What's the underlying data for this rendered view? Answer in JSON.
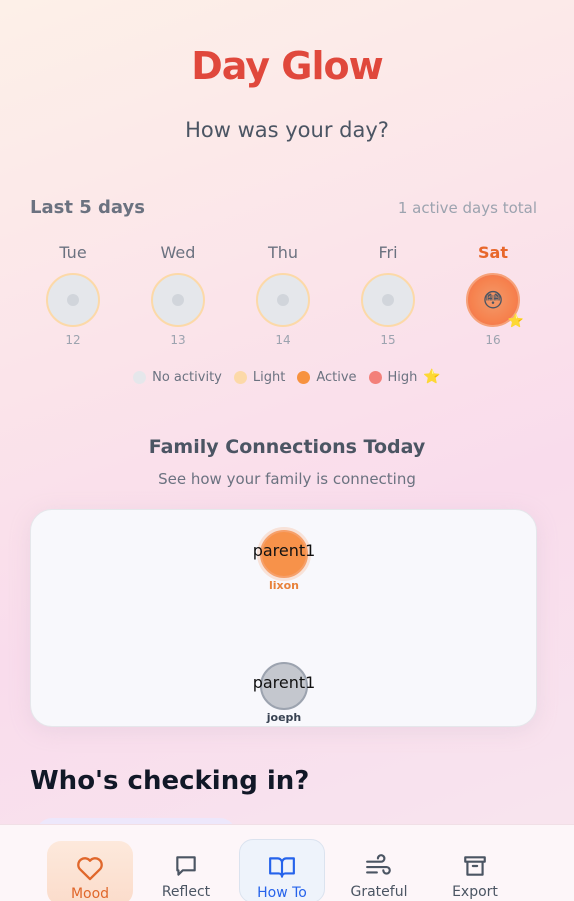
{
  "app": {
    "title": "Day Glow",
    "subtitle": "How was your day?"
  },
  "history": {
    "heading": "Last 5 days",
    "total": "1 active days total",
    "days": [
      {
        "name": "Tue",
        "num": "12",
        "level": "none"
      },
      {
        "name": "Wed",
        "num": "13",
        "level": "none"
      },
      {
        "name": "Thu",
        "num": "14",
        "level": "none"
      },
      {
        "name": "Fri",
        "num": "15",
        "level": "none"
      },
      {
        "name": "Sat",
        "num": "16",
        "level": "high",
        "emoji": "😳",
        "star": "⭐"
      }
    ],
    "legend": [
      {
        "label": "No activity",
        "color": "#e5e7eb"
      },
      {
        "label": "Light",
        "color": "#fcd9a8"
      },
      {
        "label": "Active",
        "color": "#f7923f"
      },
      {
        "label": "High",
        "color": "#f3807a",
        "star": "⭐"
      }
    ]
  },
  "family": {
    "title": "Family Connections Today",
    "subtitle": "See how your family is connecting",
    "nodes": [
      {
        "label": "parent1",
        "name": "lixon",
        "color": "orange"
      },
      {
        "label": "parent1",
        "name": "joeph",
        "color": "gray"
      }
    ]
  },
  "checkin": {
    "heading": "Who's checking in?"
  },
  "nav": {
    "items": [
      {
        "label": "Mood",
        "icon": "heart-icon"
      },
      {
        "label": "Reflect",
        "icon": "chat-icon"
      },
      {
        "label": "How To",
        "icon": "book-icon"
      },
      {
        "label": "Grateful",
        "icon": "wind-icon"
      },
      {
        "label": "Export",
        "icon": "archive-icon"
      }
    ],
    "active": "Mood"
  }
}
